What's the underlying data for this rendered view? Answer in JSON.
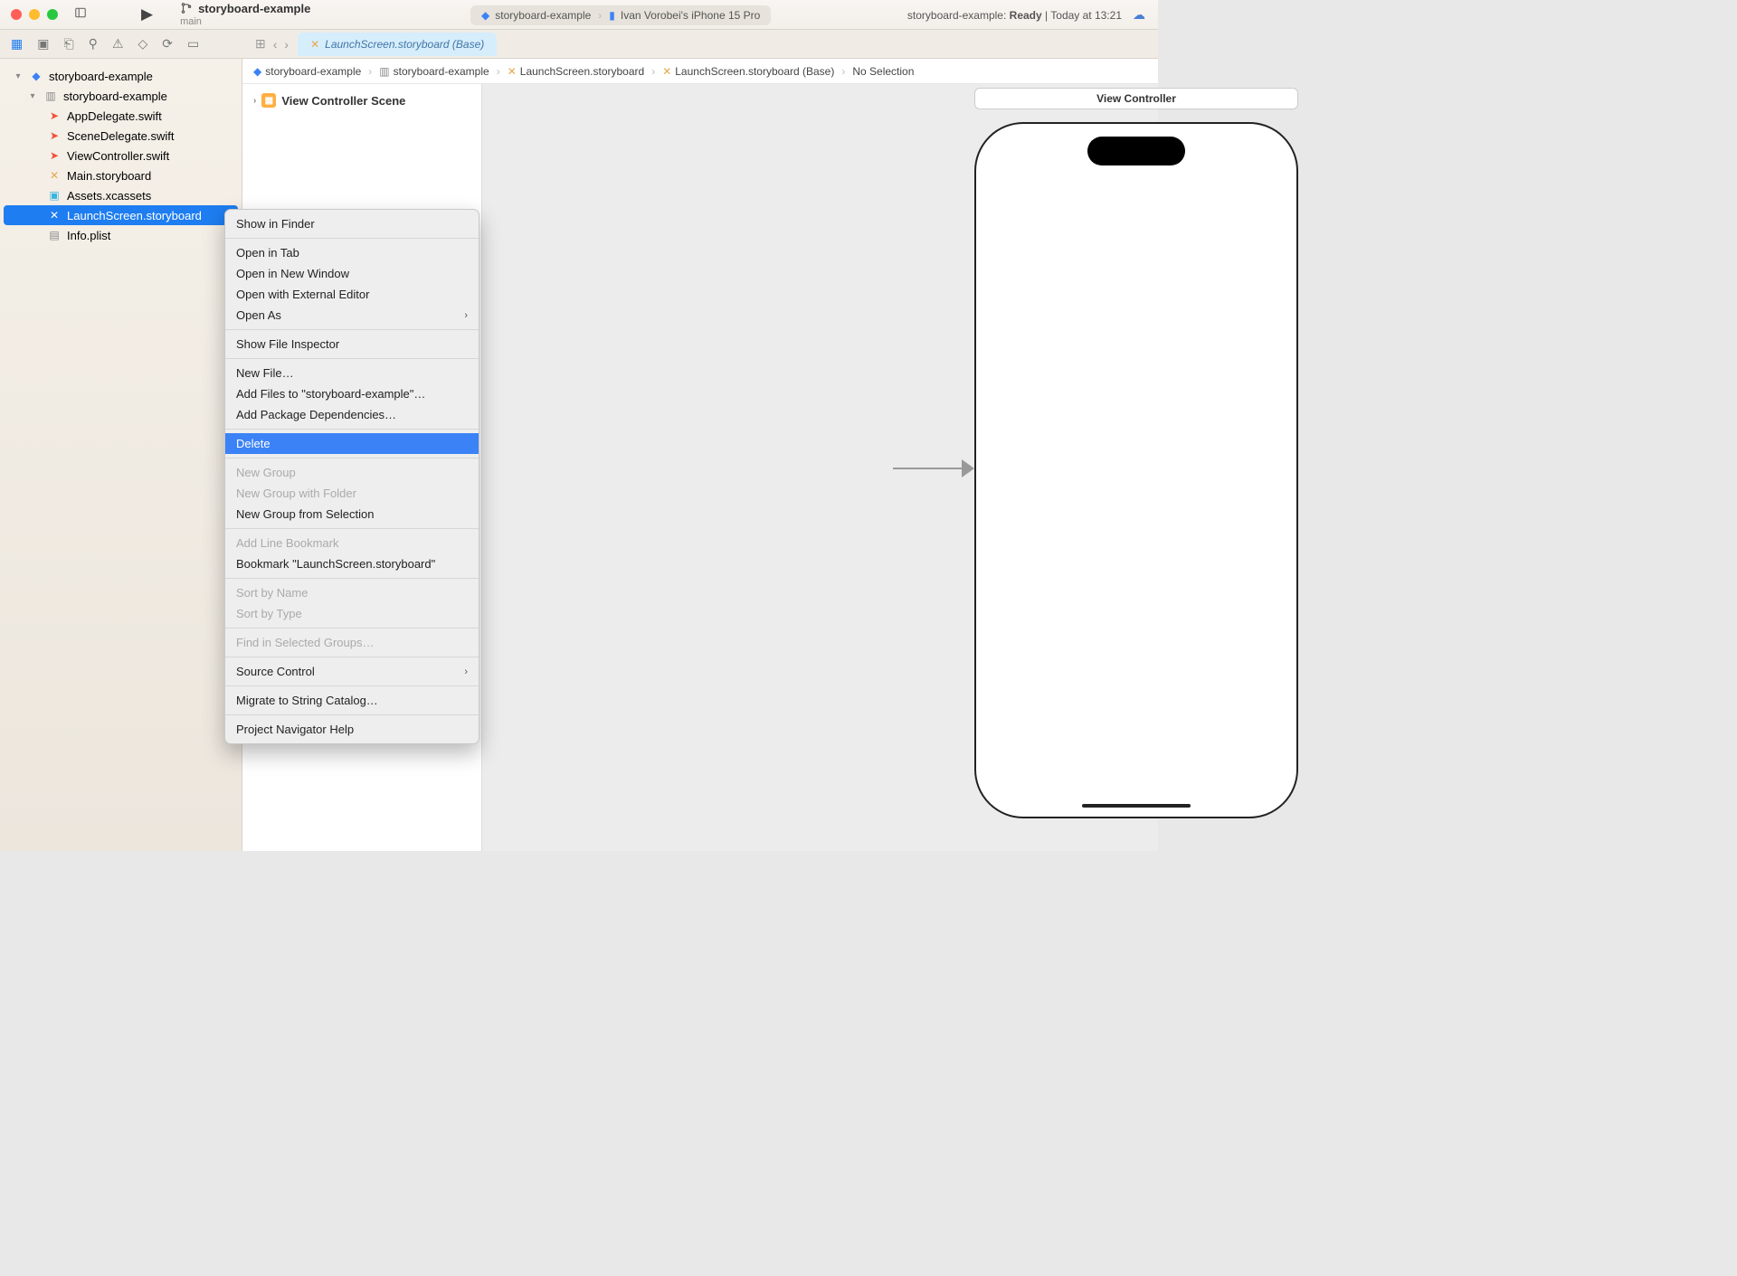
{
  "titlebar": {
    "project": "storyboard-example",
    "branch": "main",
    "pill_scheme": "storyboard-example",
    "pill_device": "Ivan Vorobei's iPhone 15 Pro",
    "status_scheme": "storyboard-example:",
    "status_ready": "Ready",
    "status_time": "Today at 13:21"
  },
  "tab": {
    "label": "LaunchScreen.storyboard (Base)"
  },
  "breadcrumb": {
    "b0": "storyboard-example",
    "b1": "storyboard-example",
    "b2": "LaunchScreen.storyboard",
    "b3": "LaunchScreen.storyboard (Base)",
    "b4": "No Selection"
  },
  "sidebar": {
    "root": "storyboard-example",
    "group": "storyboard-example",
    "files": {
      "f0": "AppDelegate.swift",
      "f1": "SceneDelegate.swift",
      "f2": "ViewController.swift",
      "f3": "Main.storyboard",
      "f4": "Assets.xcassets",
      "f5": "LaunchScreen.storyboard",
      "f6": "Info.plist"
    }
  },
  "outline": {
    "scene": "View Controller Scene"
  },
  "canvas": {
    "vc_title": "View Controller"
  },
  "menu": {
    "m0": "Show in Finder",
    "m1": "Open in Tab",
    "m2": "Open in New Window",
    "m3": "Open with External Editor",
    "m4": "Open As",
    "m5": "Show File Inspector",
    "m6": "New File…",
    "m7": "Add Files to \"storyboard-example\"…",
    "m8": "Add Package Dependencies…",
    "m9": "Delete",
    "m10": "New Group",
    "m11": "New Group with Folder",
    "m12": "New Group from Selection",
    "m13": "Add Line Bookmark",
    "m14": "Bookmark \"LaunchScreen.storyboard\"",
    "m15": "Sort by Name",
    "m16": "Sort by Type",
    "m17": "Find in Selected Groups…",
    "m18": "Source Control",
    "m19": "Migrate to String Catalog…",
    "m20": "Project Navigator Help"
  }
}
